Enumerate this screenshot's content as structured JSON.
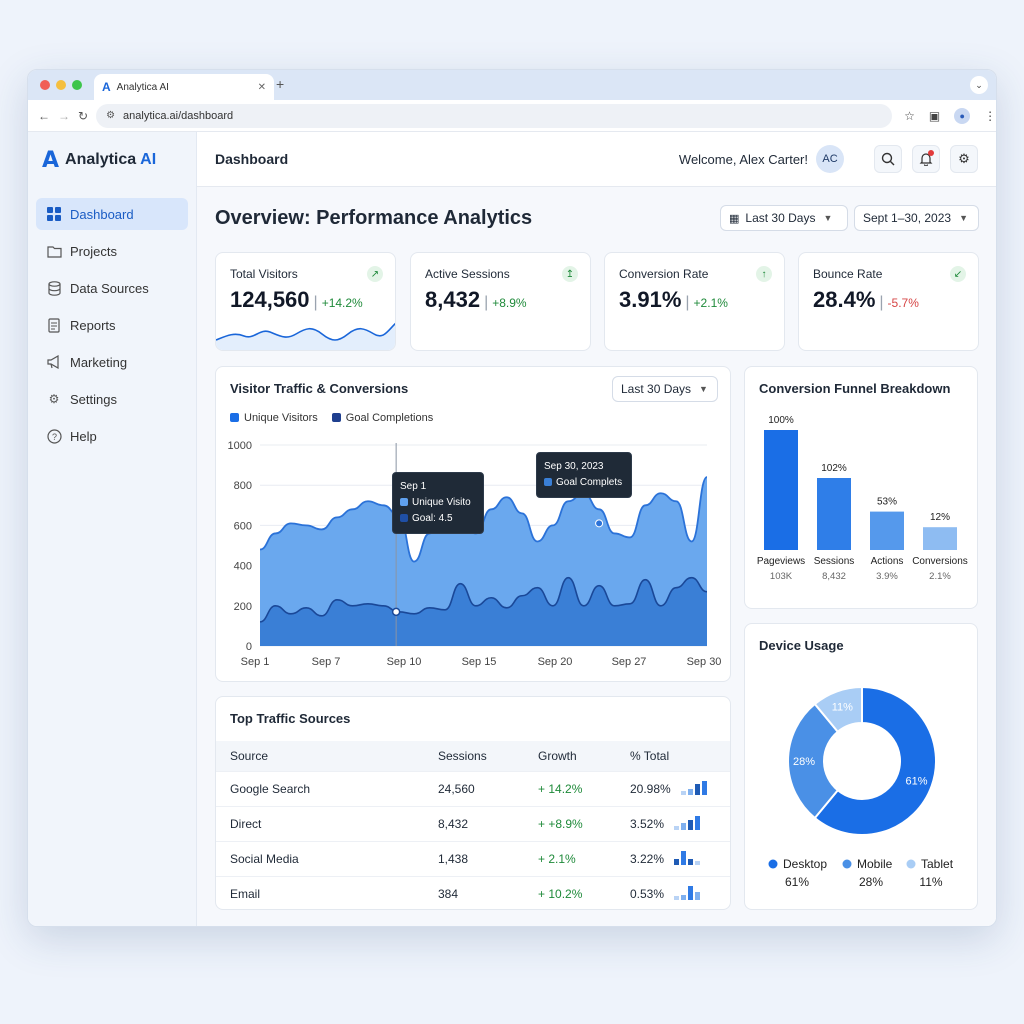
{
  "browser": {
    "tab_title": "Analytica AI",
    "url": "analytica.ai/dashboard"
  },
  "brand": {
    "name": "Analytica",
    "suffix": "AI"
  },
  "sidebar": {
    "items": [
      {
        "label": "Dashboard",
        "icon": "grid-icon",
        "active": true
      },
      {
        "label": "Projects",
        "icon": "folder-icon"
      },
      {
        "label": "Data Sources",
        "icon": "database-icon"
      },
      {
        "label": "Reports",
        "icon": "document-icon"
      },
      {
        "label": "Marketing",
        "icon": "megaphone-icon"
      },
      {
        "label": "Settings",
        "icon": "gear-icon"
      },
      {
        "label": "Help",
        "icon": "help-icon"
      }
    ]
  },
  "header": {
    "title": "Dashboard",
    "welcome": "Welcome, Alex Carter!",
    "avatar_initials": "AC"
  },
  "overview": {
    "title": "Overview: Performance Analytics",
    "range_select": "Last 30 Days",
    "date_select": "Sept 1–30, 2023"
  },
  "kpis": [
    {
      "label": "Total Visitors",
      "value": "124,560",
      "change": "+14.2%",
      "trend": "up"
    },
    {
      "label": "Active Sessions",
      "value": "8,432",
      "change": "+8.9%",
      "trend": "up"
    },
    {
      "label": "Conversion Rate",
      "value": "3.91%",
      "change": "+2.1%",
      "trend": "up"
    },
    {
      "label": "Bounce Rate",
      "value": "28.4%",
      "change": "-5.7%",
      "trend": "down"
    }
  ],
  "traffic": {
    "title": "Visitor Traffic & Conversions",
    "range_select": "Last 30 Days",
    "tooltip1": {
      "title": "Sep 1",
      "line1": "Unique Visito",
      "line2": "Goal: 4.5"
    },
    "tooltip2": {
      "title": "Sep 30, 2023",
      "line1": "Goal Complets"
    }
  },
  "funnel": {
    "title": "Conversion Funnel Breakdown"
  },
  "sources": {
    "title": "Top Traffic Sources",
    "headers": [
      "Source",
      "Sessions",
      "Growth",
      "% Total"
    ],
    "rows": [
      {
        "source": "Google Search",
        "sessions": "24,560",
        "growth": "+ 14.2%",
        "pct": "20.98%",
        "spark": [
          3,
          4,
          8,
          10
        ]
      },
      {
        "source": "Direct",
        "sessions": "8,432",
        "growth": "+ +8.9%",
        "pct": "3.52%",
        "spark": [
          3,
          5,
          7,
          10
        ]
      },
      {
        "source": "Social Media",
        "sessions": "1,438",
        "growth": "+ 2.1%",
        "pct": "3.22%",
        "spark": [
          4,
          10,
          4,
          3
        ]
      },
      {
        "source": "Email",
        "sessions": "384",
        "growth": "+ 10.2%",
        "pct": "0.53%",
        "spark": [
          3,
          4,
          10,
          6
        ]
      }
    ]
  },
  "device": {
    "title": "Device Usage"
  },
  "colors": {
    "primary": "#1a66d9",
    "area_light": "#6aa8ee",
    "area_dark": "#3a7fd6",
    "positive": "#1f8a3a",
    "negative": "#d64545"
  },
  "chart_data": [
    {
      "type": "area",
      "title": "Visitor Traffic & Conversions",
      "x_ticks": [
        "Sep 1",
        "Sep 7",
        "Sep 10",
        "Sep 15",
        "Sep 20",
        "Sep 27",
        "Sep 30"
      ],
      "y_ticks": [
        "0",
        "200",
        "400",
        "600",
        "800",
        "1000"
      ],
      "ylim": [
        0,
        1000
      ],
      "grid": true,
      "legend_placement": "top-left",
      "series": [
        {
          "name": "Unique Visitors",
          "color": "#6aa8ee",
          "x": [
            1,
            2,
            3,
            4,
            5,
            6,
            7,
            8,
            9,
            10,
            11,
            12,
            13,
            14,
            15,
            16,
            17,
            18,
            19,
            20,
            21,
            22,
            23,
            24,
            25,
            26,
            27,
            28,
            29,
            30
          ],
          "values": [
            480,
            560,
            610,
            600,
            580,
            640,
            680,
            720,
            700,
            650,
            420,
            560,
            640,
            620,
            560,
            680,
            740,
            660,
            520,
            600,
            720,
            760,
            680,
            560,
            540,
            700,
            760,
            720,
            520,
            840
          ]
        },
        {
          "name": "Goal Completions",
          "color": "#1f5bb5",
          "x": [
            1,
            2,
            3,
            4,
            5,
            6,
            7,
            8,
            9,
            10,
            11,
            12,
            13,
            14,
            15,
            16,
            17,
            18,
            19,
            20,
            21,
            22,
            23,
            24,
            25,
            26,
            27,
            28,
            29,
            30
          ],
          "values": [
            120,
            200,
            160,
            190,
            150,
            230,
            200,
            210,
            200,
            170,
            160,
            190,
            180,
            310,
            200,
            240,
            190,
            250,
            290,
            200,
            340,
            200,
            300,
            200,
            210,
            330,
            200,
            290,
            340,
            270
          ]
        }
      ]
    },
    {
      "type": "bar",
      "title": "Conversion Funnel Breakdown",
      "categories": [
        "Pageviews",
        "Sessions",
        "Actions",
        "Conversions"
      ],
      "values": [
        100,
        102,
        53,
        12
      ],
      "value_labels": [
        "100%",
        "102%",
        "53%",
        "12%"
      ],
      "sublabels": [
        "103K",
        "8,432",
        "3.9%",
        "2.1%"
      ],
      "bar_heights_pct": [
        100,
        60,
        32,
        19
      ]
    },
    {
      "type": "pie",
      "title": "Device Usage",
      "categories": [
        "Desktop",
        "Mobile",
        "Tablet"
      ],
      "values": [
        61,
        28,
        11
      ],
      "labels": [
        "61%",
        "28%",
        "11%"
      ],
      "colors": [
        "#1a6ee6",
        "#4a90e6",
        "#a9cdf5"
      ]
    }
  ]
}
